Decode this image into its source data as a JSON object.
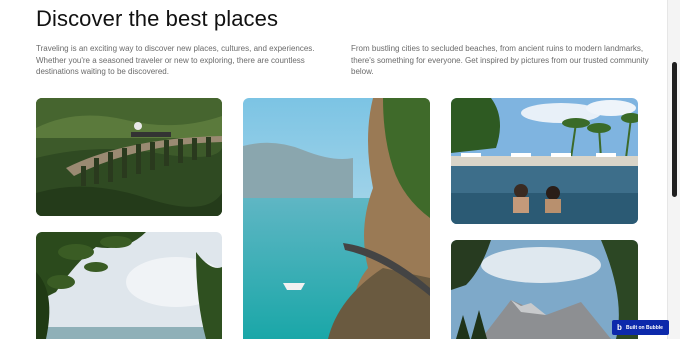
{
  "section": {
    "title": "Discover the best places",
    "intro_left": "Traveling is an exciting way to discover new places, cultures, and experiences. Whether you're a seasoned traveler or new to exploring, there are countless destinations waiting to be discovered.",
    "intro_right": "From bustling cities to secluded beaches, from ancient ruins to modern landmarks, there's something for everyone. Get inspired by pictures from our trusted community below."
  },
  "gallery": {
    "photos": [
      {
        "subject": "steam train crossing stone viaduct in green valley"
      },
      {
        "subject": "coastal cliff road above turquoise sea with ferry"
      },
      {
        "subject": "infinity pool with palm trees and two swimmers"
      },
      {
        "subject": "tropical beach framed by leaves under cloudy sky"
      },
      {
        "subject": "rocky mountain behind pine trees"
      }
    ]
  },
  "badge": {
    "logo": "b",
    "label": "Built on Bubble"
  },
  "colors": {
    "badge_bg": "#0c29ab",
    "body_text": "#6b6b6b",
    "heading": "#111111"
  }
}
